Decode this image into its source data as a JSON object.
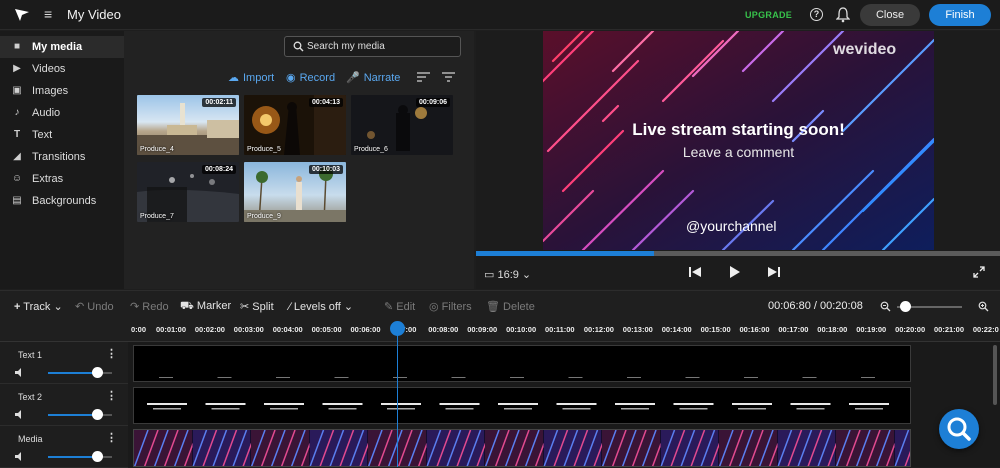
{
  "app": {
    "title": "My Video",
    "upgrade": "UPGRADE",
    "close_label": "Close",
    "finish_label": "Finish"
  },
  "sidebar": {
    "items": [
      {
        "label": "My media",
        "icon": "folder-icon"
      },
      {
        "label": "Videos",
        "icon": "video-icon"
      },
      {
        "label": "Images",
        "icon": "image-icon"
      },
      {
        "label": "Audio",
        "icon": "music-icon"
      },
      {
        "label": "Text",
        "icon": "text-icon"
      },
      {
        "label": "Transitions",
        "icon": "transition-icon"
      },
      {
        "label": "Extras",
        "icon": "smiley-icon"
      },
      {
        "label": "Backgrounds",
        "icon": "layers-icon"
      }
    ]
  },
  "media": {
    "search_placeholder": "Search my media",
    "actions": {
      "import": "Import",
      "record": "Record",
      "narrate": "Narrate"
    },
    "items": [
      {
        "name": "Produce_4",
        "duration": "00:02:11"
      },
      {
        "name": "Produce_5",
        "duration": "00:04:13"
      },
      {
        "name": "Produce_6",
        "duration": "00:09:06"
      },
      {
        "name": "Produce_7",
        "duration": "00:08:24"
      },
      {
        "name": "Produce_9",
        "duration": "00:10:03"
      }
    ]
  },
  "preview": {
    "headline": "Live stream starting soon!",
    "subline": "Leave a comment",
    "handle": "@yourchannel",
    "watermark": "wevideo",
    "aspect": "16:9",
    "progress": 0.34
  },
  "toolbar": {
    "track": "Track",
    "undo": "Undo",
    "redo": "Redo",
    "marker": "Marker",
    "split": "Split",
    "levels": "Levels off",
    "edit": "Edit",
    "filters": "Filters",
    "delete": "Delete",
    "time": "00:06:80 / 00:20:08"
  },
  "ruler": {
    "ticks": [
      "0:00",
      "00:01:00",
      "00:02:00",
      "00:03:00",
      "00:04:00",
      "00:05:00",
      "00:06:00",
      "7:00",
      "00:08:00",
      "00:09:00",
      "00:10:00",
      "00:11:00",
      "00:12:00",
      "00:13:00",
      "00:14:00",
      "00:15:00",
      "00:16:00",
      "00:17:00",
      "00:18:00",
      "00:19:00",
      "00:20:00",
      "00:21:00",
      "00:22:0"
    ]
  },
  "tracks": [
    {
      "name": "Text 1"
    },
    {
      "name": "Text 2"
    },
    {
      "name": "Media"
    }
  ],
  "colors": {
    "accent": "#1d7fd6",
    "upgrade": "#37c24b",
    "link": "#5aa8f0"
  }
}
